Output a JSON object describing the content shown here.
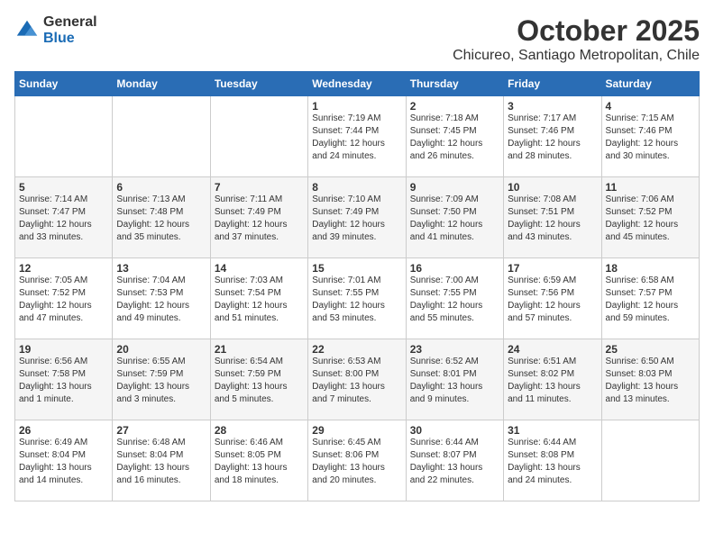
{
  "header": {
    "logo_general": "General",
    "logo_blue": "Blue",
    "main_title": "October 2025",
    "subtitle": "Chicureo, Santiago Metropolitan, Chile"
  },
  "days_of_week": [
    "Sunday",
    "Monday",
    "Tuesday",
    "Wednesday",
    "Thursday",
    "Friday",
    "Saturday"
  ],
  "weeks": [
    [
      {
        "day": "",
        "info": ""
      },
      {
        "day": "",
        "info": ""
      },
      {
        "day": "",
        "info": ""
      },
      {
        "day": "1",
        "info": "Sunrise: 7:19 AM\nSunset: 7:44 PM\nDaylight: 12 hours\nand 24 minutes."
      },
      {
        "day": "2",
        "info": "Sunrise: 7:18 AM\nSunset: 7:45 PM\nDaylight: 12 hours\nand 26 minutes."
      },
      {
        "day": "3",
        "info": "Sunrise: 7:17 AM\nSunset: 7:46 PM\nDaylight: 12 hours\nand 28 minutes."
      },
      {
        "day": "4",
        "info": "Sunrise: 7:15 AM\nSunset: 7:46 PM\nDaylight: 12 hours\nand 30 minutes."
      }
    ],
    [
      {
        "day": "5",
        "info": "Sunrise: 7:14 AM\nSunset: 7:47 PM\nDaylight: 12 hours\nand 33 minutes."
      },
      {
        "day": "6",
        "info": "Sunrise: 7:13 AM\nSunset: 7:48 PM\nDaylight: 12 hours\nand 35 minutes."
      },
      {
        "day": "7",
        "info": "Sunrise: 7:11 AM\nSunset: 7:49 PM\nDaylight: 12 hours\nand 37 minutes."
      },
      {
        "day": "8",
        "info": "Sunrise: 7:10 AM\nSunset: 7:49 PM\nDaylight: 12 hours\nand 39 minutes."
      },
      {
        "day": "9",
        "info": "Sunrise: 7:09 AM\nSunset: 7:50 PM\nDaylight: 12 hours\nand 41 minutes."
      },
      {
        "day": "10",
        "info": "Sunrise: 7:08 AM\nSunset: 7:51 PM\nDaylight: 12 hours\nand 43 minutes."
      },
      {
        "day": "11",
        "info": "Sunrise: 7:06 AM\nSunset: 7:52 PM\nDaylight: 12 hours\nand 45 minutes."
      }
    ],
    [
      {
        "day": "12",
        "info": "Sunrise: 7:05 AM\nSunset: 7:52 PM\nDaylight: 12 hours\nand 47 minutes."
      },
      {
        "day": "13",
        "info": "Sunrise: 7:04 AM\nSunset: 7:53 PM\nDaylight: 12 hours\nand 49 minutes."
      },
      {
        "day": "14",
        "info": "Sunrise: 7:03 AM\nSunset: 7:54 PM\nDaylight: 12 hours\nand 51 minutes."
      },
      {
        "day": "15",
        "info": "Sunrise: 7:01 AM\nSunset: 7:55 PM\nDaylight: 12 hours\nand 53 minutes."
      },
      {
        "day": "16",
        "info": "Sunrise: 7:00 AM\nSunset: 7:55 PM\nDaylight: 12 hours\nand 55 minutes."
      },
      {
        "day": "17",
        "info": "Sunrise: 6:59 AM\nSunset: 7:56 PM\nDaylight: 12 hours\nand 57 minutes."
      },
      {
        "day": "18",
        "info": "Sunrise: 6:58 AM\nSunset: 7:57 PM\nDaylight: 12 hours\nand 59 minutes."
      }
    ],
    [
      {
        "day": "19",
        "info": "Sunrise: 6:56 AM\nSunset: 7:58 PM\nDaylight: 13 hours\nand 1 minute."
      },
      {
        "day": "20",
        "info": "Sunrise: 6:55 AM\nSunset: 7:59 PM\nDaylight: 13 hours\nand 3 minutes."
      },
      {
        "day": "21",
        "info": "Sunrise: 6:54 AM\nSunset: 7:59 PM\nDaylight: 13 hours\nand 5 minutes."
      },
      {
        "day": "22",
        "info": "Sunrise: 6:53 AM\nSunset: 8:00 PM\nDaylight: 13 hours\nand 7 minutes."
      },
      {
        "day": "23",
        "info": "Sunrise: 6:52 AM\nSunset: 8:01 PM\nDaylight: 13 hours\nand 9 minutes."
      },
      {
        "day": "24",
        "info": "Sunrise: 6:51 AM\nSunset: 8:02 PM\nDaylight: 13 hours\nand 11 minutes."
      },
      {
        "day": "25",
        "info": "Sunrise: 6:50 AM\nSunset: 8:03 PM\nDaylight: 13 hours\nand 13 minutes."
      }
    ],
    [
      {
        "day": "26",
        "info": "Sunrise: 6:49 AM\nSunset: 8:04 PM\nDaylight: 13 hours\nand 14 minutes."
      },
      {
        "day": "27",
        "info": "Sunrise: 6:48 AM\nSunset: 8:04 PM\nDaylight: 13 hours\nand 16 minutes."
      },
      {
        "day": "28",
        "info": "Sunrise: 6:46 AM\nSunset: 8:05 PM\nDaylight: 13 hours\nand 18 minutes."
      },
      {
        "day": "29",
        "info": "Sunrise: 6:45 AM\nSunset: 8:06 PM\nDaylight: 13 hours\nand 20 minutes."
      },
      {
        "day": "30",
        "info": "Sunrise: 6:44 AM\nSunset: 8:07 PM\nDaylight: 13 hours\nand 22 minutes."
      },
      {
        "day": "31",
        "info": "Sunrise: 6:44 AM\nSunset: 8:08 PM\nDaylight: 13 hours\nand 24 minutes."
      },
      {
        "day": "",
        "info": ""
      }
    ]
  ]
}
